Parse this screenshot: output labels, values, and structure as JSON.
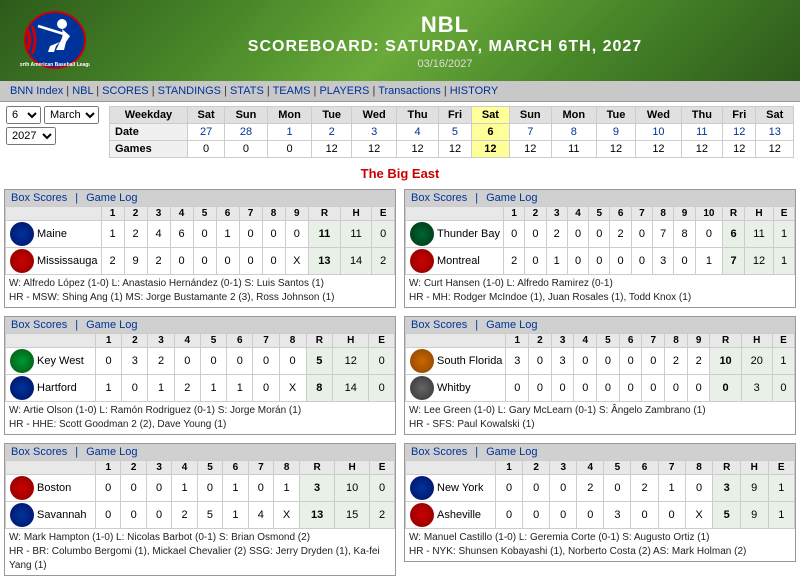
{
  "header": {
    "league": "NBL",
    "subtitle": "SCOREBOARD: SATURDAY, MARCH 6TH, 2027",
    "date": "03/16/2027"
  },
  "nav": {
    "items": [
      "BNN Index",
      "NBL",
      "SCORES",
      "STANDINGS",
      "STATS",
      "TEAMS",
      "PLAYERS",
      "Transactions",
      "HISTORY"
    ]
  },
  "controls": {
    "month_label": "March",
    "month_value": "6",
    "year_value": "2027",
    "calendar": {
      "headers": [
        "Weekday",
        "Sat",
        "Sun",
        "Mon",
        "Tue",
        "Wed",
        "Thu",
        "Fri",
        "Sat",
        "Sun",
        "Mon",
        "Tue",
        "Wed",
        "Thu",
        "Fri",
        "Sat"
      ],
      "row1_label": "Date",
      "row1": [
        "27",
        "28",
        "1",
        "2",
        "3",
        "4",
        "5",
        "6",
        "7",
        "8",
        "9",
        "10",
        "11",
        "12",
        "13"
      ],
      "row2_label": "Games",
      "row2": [
        "0",
        "0",
        "0",
        "12",
        "12",
        "12",
        "12",
        "12",
        "12",
        "11",
        "12",
        "12",
        "12",
        "12",
        "12"
      ]
    }
  },
  "section_title": "The Big East",
  "games": [
    {
      "id": "game1",
      "col": "left",
      "header_links": [
        "Box Scores",
        "Game Log"
      ],
      "teams": [
        {
          "name": "Maine",
          "logo_class": "logo-maine",
          "innings": [
            "1",
            "2",
            "4",
            "6",
            "0",
            "1",
            "0",
            "0",
            "0"
          ],
          "r": "11",
          "h": "11",
          "e": "0"
        },
        {
          "name": "Mississauga",
          "logo_class": "logo-mississauga",
          "innings": [
            "2",
            "9",
            "2",
            "0",
            "0",
            "0",
            "0",
            "0",
            "X"
          ],
          "r": "13",
          "h": "14",
          "e": "2"
        }
      ],
      "notes": [
        "W: Alfredo López (1-0) L: Anastasio Hernández (0-1) S: Luis Santos (1)",
        "HR - MSW: Shing Ang (1) MS: Jorge Bustamante 2 (3), Ross Johnson (1)"
      ]
    },
    {
      "id": "game2",
      "col": "right",
      "header_links": [
        "Box Scores",
        "Game Log"
      ],
      "teams": [
        {
          "name": "Thunder Bay",
          "logo_class": "logo-thunderbay",
          "innings": [
            "0",
            "0",
            "2",
            "0",
            "0",
            "2",
            "0",
            "7",
            "8",
            "0"
          ],
          "r": "6",
          "h": "11",
          "e": "1"
        },
        {
          "name": "Montreal",
          "logo_class": "logo-montreal",
          "innings": [
            "2",
            "0",
            "1",
            "0",
            "0",
            "0",
            "0",
            "3",
            "0",
            "1"
          ],
          "r": "7",
          "h": "12",
          "e": "1"
        }
      ],
      "ten_innings": true,
      "notes": [
        "W: Curt Hansen (1-0) L: Alfredo Ramirez (0-1)",
        "HR - MH: Rodger McIndoe (1), Juan Rosales (1), Todd Knox (1)"
      ]
    },
    {
      "id": "game3",
      "col": "left",
      "header_links": [
        "Box Scores",
        "Game Log"
      ],
      "teams": [
        {
          "name": "Key West",
          "logo_class": "logo-keywest",
          "innings": [
            "0",
            "3",
            "2",
            "0",
            "0",
            "0",
            "0",
            "0"
          ],
          "r": "5",
          "h": "12",
          "e": "0"
        },
        {
          "name": "Hartford",
          "logo_class": "logo-hartford",
          "innings": [
            "1",
            "0",
            "1",
            "2",
            "1",
            "1",
            "0",
            "X"
          ],
          "r": "8",
          "h": "14",
          "e": "0"
        }
      ],
      "notes": [
        "W: Artie Olson (1-0) L: Ramón Rodriguez (0-1) S: Jorge Morán (1)",
        "HR - HHE: Scott Goodman 2 (2), Dave Young (1)"
      ]
    },
    {
      "id": "game4",
      "col": "right",
      "header_links": [
        "Box Scores",
        "Game Log"
      ],
      "teams": [
        {
          "name": "South Florida",
          "logo_class": "logo-southflorida",
          "innings": [
            "3",
            "0",
            "3",
            "0",
            "0",
            "0",
            "0",
            "2",
            "2"
          ],
          "r": "10",
          "h": "20",
          "e": "1"
        },
        {
          "name": "Whitby",
          "logo_class": "logo-whitby",
          "innings": [
            "0",
            "0",
            "0",
            "0",
            "0",
            "0",
            "0",
            "0",
            "0"
          ],
          "r": "0",
          "h": "3",
          "e": "0"
        }
      ],
      "notes": [
        "W: Lee Green (1-0) L: Gary McLearn (0-1) S: Ângelo Zambrano (1)",
        "HR - SFS: Paul Kowalski (1)"
      ]
    },
    {
      "id": "game5",
      "col": "left",
      "header_links": [
        "Box Scores",
        "Game Log"
      ],
      "teams": [
        {
          "name": "Boston",
          "logo_class": "logo-boston",
          "innings": [
            "0",
            "0",
            "0",
            "1",
            "0",
            "1",
            "0",
            "1"
          ],
          "r": "3",
          "h": "10",
          "e": "0"
        },
        {
          "name": "Savannah",
          "logo_class": "logo-savannah",
          "innings": [
            "0",
            "0",
            "0",
            "2",
            "5",
            "1",
            "4",
            "X"
          ],
          "r": "13",
          "h": "15",
          "e": "2"
        }
      ],
      "notes": [
        "W: Mark Hampton (1-0) L: Nicolas Barbot (0-1) S: Brian Osmond (2)",
        "HR - BR: Columbo Bergomi (1), Mickael Chevalier (2) SSG: Jerry Dryden (1), Ka-fei Yang (1)"
      ]
    },
    {
      "id": "game6",
      "col": "right",
      "header_links": [
        "Box Scores",
        "Game Log"
      ],
      "teams": [
        {
          "name": "New York",
          "logo_class": "logo-newyork",
          "innings": [
            "0",
            "0",
            "0",
            "2",
            "0",
            "2",
            "1",
            "0"
          ],
          "r": "3",
          "h": "9",
          "e": "1"
        },
        {
          "name": "Asheville",
          "logo_class": "logo-asheville",
          "innings": [
            "0",
            "0",
            "0",
            "0",
            "3",
            "0",
            "0",
            "X"
          ],
          "r": "5",
          "h": "9",
          "e": "1"
        }
      ],
      "notes": [
        "W: Manuel Castillo (1-0) L: Geremia Corte (0-1) S: Augusto Ortiz (1)",
        "HR - NYK: Shunsen Kobayashi (1), Norberto Costa (2) AS: Mark Holman (2)"
      ]
    }
  ]
}
